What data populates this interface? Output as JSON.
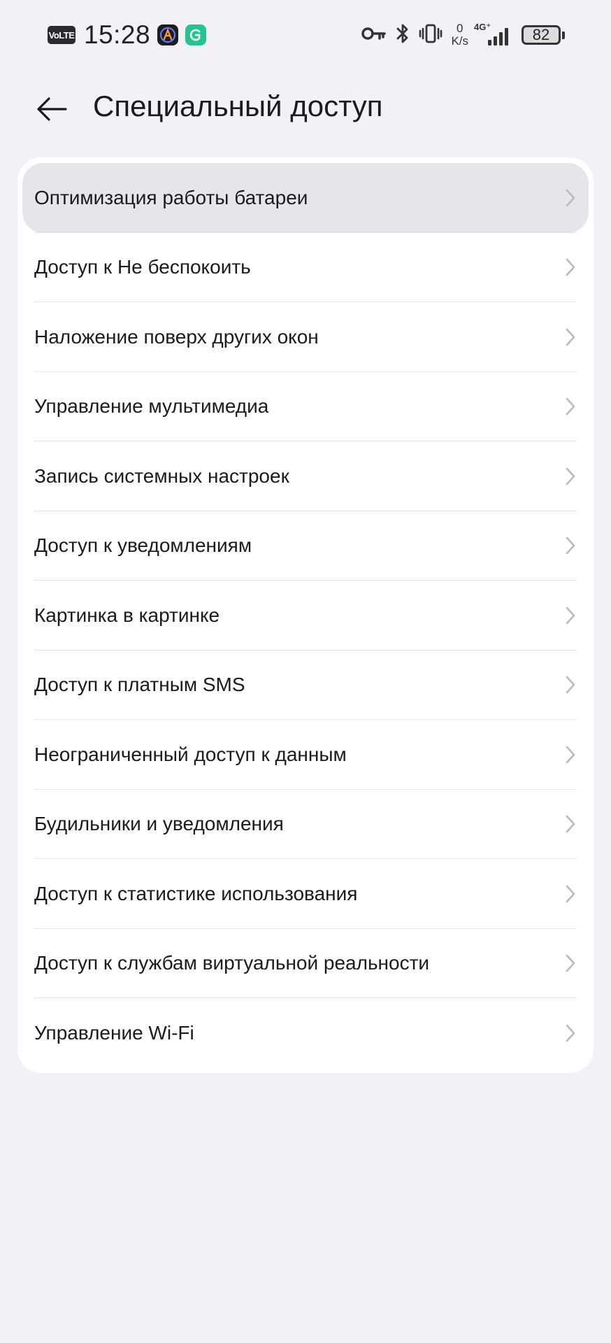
{
  "status_bar": {
    "volte": "VoLTE",
    "time": "15:28",
    "net_speed_value": "0",
    "net_speed_unit": "K/s",
    "network_type": "4G⁺",
    "battery_percent": "82",
    "icons": [
      "volte-icon",
      "vpn-app-icon",
      "green-app-icon",
      "key-icon",
      "bluetooth-icon",
      "vibrate-icon",
      "signal-icon",
      "battery-icon"
    ]
  },
  "header": {
    "back_icon": "arrow-left-icon",
    "title": "Специальный доступ"
  },
  "list": {
    "items": [
      {
        "label": "Оптимизация работы батареи",
        "pressed": true
      },
      {
        "label": "Доступ к Не беспокоить"
      },
      {
        "label": "Наложение поверх других окон"
      },
      {
        "label": "Управление мультимедиа"
      },
      {
        "label": "Запись системных настроек"
      },
      {
        "label": "Доступ к уведомлениям"
      },
      {
        "label": "Картинка в картинке"
      },
      {
        "label": "Доступ к платным SMS"
      },
      {
        "label": "Неограниченный доступ к данным"
      },
      {
        "label": "Будильники и уведомления"
      },
      {
        "label": "Доступ к статистике использования"
      },
      {
        "label": "Доступ к службам виртуальной реальности"
      },
      {
        "label": "Управление Wi-Fi"
      }
    ]
  },
  "colors": {
    "background": "#f2f1f6",
    "card": "#ffffff",
    "pressed": "#e6e5ea",
    "text": "#1b1b1d",
    "chevron": "#b9b9be"
  }
}
